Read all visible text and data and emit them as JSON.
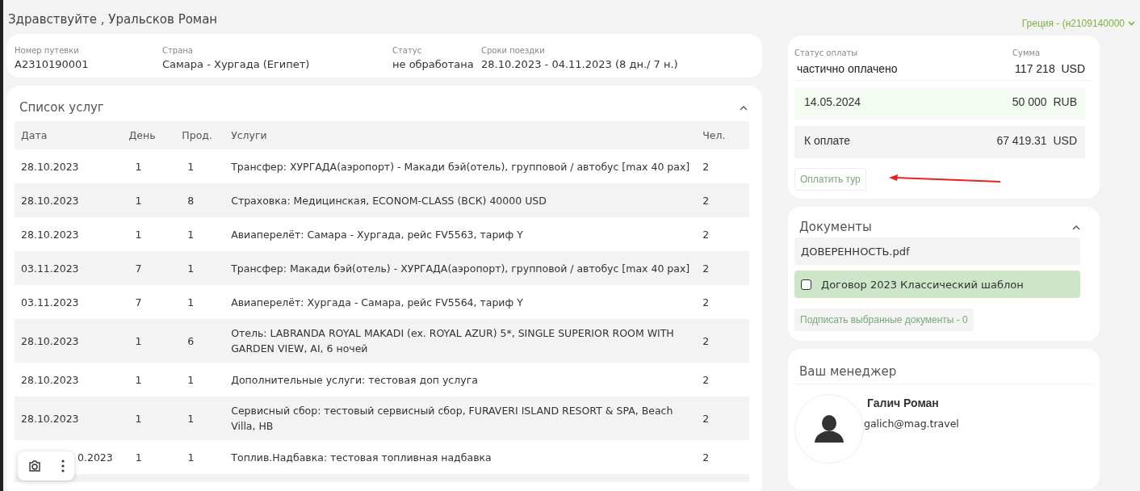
{
  "greeting": "Здравствуйте , Уральсков Роман",
  "account_switch": {
    "label": "Греция - (н2109140000",
    "expanded": false
  },
  "trip": [
    {
      "label": "Номер путевки",
      "value": "A2310190001"
    },
    {
      "label": "Страна",
      "value": "Самара - Хургада (Египет)"
    },
    {
      "label": "Статус",
      "value": "не обработана"
    },
    {
      "label": "Сроки поездки",
      "value": "28.10.2023 - 04.11.2023 (8 дн./ 7 н.)"
    }
  ],
  "services": {
    "title": "Список услуг",
    "expanded": true,
    "columns": [
      "Дата",
      "День",
      "Прод.",
      "Услуги",
      "Чел."
    ],
    "rows": [
      [
        "28.10.2023",
        "1",
        "1",
        "Трансфер: ХУРГАДА(аэропорт) - Макади бэй(отель), групповой / автобус [max 40 pax]",
        "2"
      ],
      [
        "28.10.2023",
        "1",
        "8",
        "Страховка: Медицинская, ECONOM-CLASS (ВСК) 40000 USD",
        "2"
      ],
      [
        "28.10.2023",
        "1",
        "1",
        "Авиаперелёт: Самара - Хургада, рейс FV5563, тариф Y",
        "2"
      ],
      [
        "03.11.2023",
        "7",
        "1",
        "Трансфер: Макади бэй(отель) - ХУРГАДА(аэропорт), групповой / автобус [max 40 pax]",
        "2"
      ],
      [
        "03.11.2023",
        "7",
        "1",
        "Авиаперелёт: Хургада - Самара, рейс FV5564, тариф Y",
        "2"
      ],
      [
        "28.10.2023",
        "1",
        "6",
        "Отель: LABRANDA ROYAL MAKADI (ex. ROYAL AZUR) 5*, SINGLE SUPERIOR ROOM WITH GARDEN VIEW, AI, 6 ночей",
        "2"
      ],
      [
        "28.10.2023",
        "1",
        "1",
        "Дополнительные услуги: тестовая доп услуга",
        "2"
      ],
      [
        "28.10.2023",
        "1",
        "1",
        "Сервисный сбор: тестовый сервисный сбор, FURAVERI ISLAND RESORT & SPA, Beach Villa, HB",
        "2"
      ],
      [
        "0.2023",
        "1",
        "1",
        "Топлив.Надбавка: тестовая топливная надбавка",
        "2"
      ]
    ]
  },
  "payment": {
    "status_label": "Статус оплаты",
    "status": "частично оплачено",
    "sum_label": "Сумма",
    "sum": "117 218",
    "sum_currency": "USD",
    "entries": [
      {
        "kind": "paid",
        "label": "14.05.2024",
        "amount": "50 000",
        "currency": "RUB"
      },
      {
        "kind": "due",
        "label": "К оплате",
        "amount": "67 419.31",
        "currency": "USD"
      }
    ],
    "pay_button": "Оплатить тур"
  },
  "documents": {
    "title": "Документы",
    "expanded": true,
    "items": [
      {
        "kind": "file",
        "name": "ДОВЕРЕННОСТЬ.pdf"
      },
      {
        "kind": "signable",
        "name": "Договор 2023 Классический шаблон",
        "checked": false
      }
    ],
    "sign_button": "Подписать выбранные документы - 0"
  },
  "manager": {
    "title": "Ваш менеджер",
    "name": "Галич Роман",
    "email": "galich@mag.travel"
  }
}
